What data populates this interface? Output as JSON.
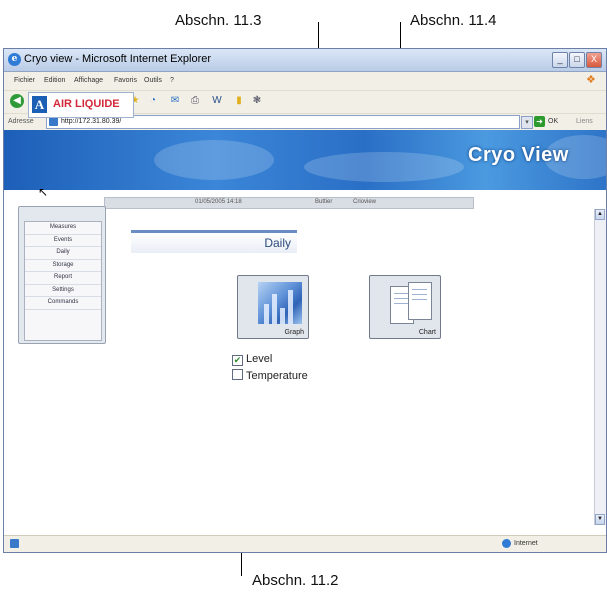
{
  "callouts": {
    "top_left": "Abschn. 11.3",
    "top_right": "Abschn.  11.4",
    "bottom": "Abschn. 11.2"
  },
  "window": {
    "title": "Cryo view - Microsoft Internet Explorer",
    "min_label": "_",
    "max_label": "□",
    "close_label": "X"
  },
  "menubar": {
    "items": [
      "Fichier",
      "Edition",
      "Affichage",
      "Favoris",
      "Outils",
      "?"
    ]
  },
  "addressbar": {
    "label": "Adresse",
    "url": "http://172.31.80.39/",
    "go_label": "OK",
    "links_label": "Liens"
  },
  "banner": {
    "logo_mark": "A",
    "logo_text": "AIR LIQUIDE",
    "brand": "Cryo View"
  },
  "status_strip": {
    "datetime": "01/05/2005 14:18",
    "user": "Buttier",
    "app": "Crioview"
  },
  "sidebar": {
    "items": [
      "Measures",
      "Events",
      "Daily",
      "Storage",
      "Report",
      "Settings",
      "Commands"
    ]
  },
  "section": {
    "title": "Daily"
  },
  "tiles": {
    "graph_label": "Graph",
    "chart_label": "Chart"
  },
  "options": {
    "level_label": "Level",
    "level_checked": true,
    "temperature_label": "Temperature",
    "temperature_checked": false
  },
  "statusbar": {
    "zone": "Internet"
  }
}
